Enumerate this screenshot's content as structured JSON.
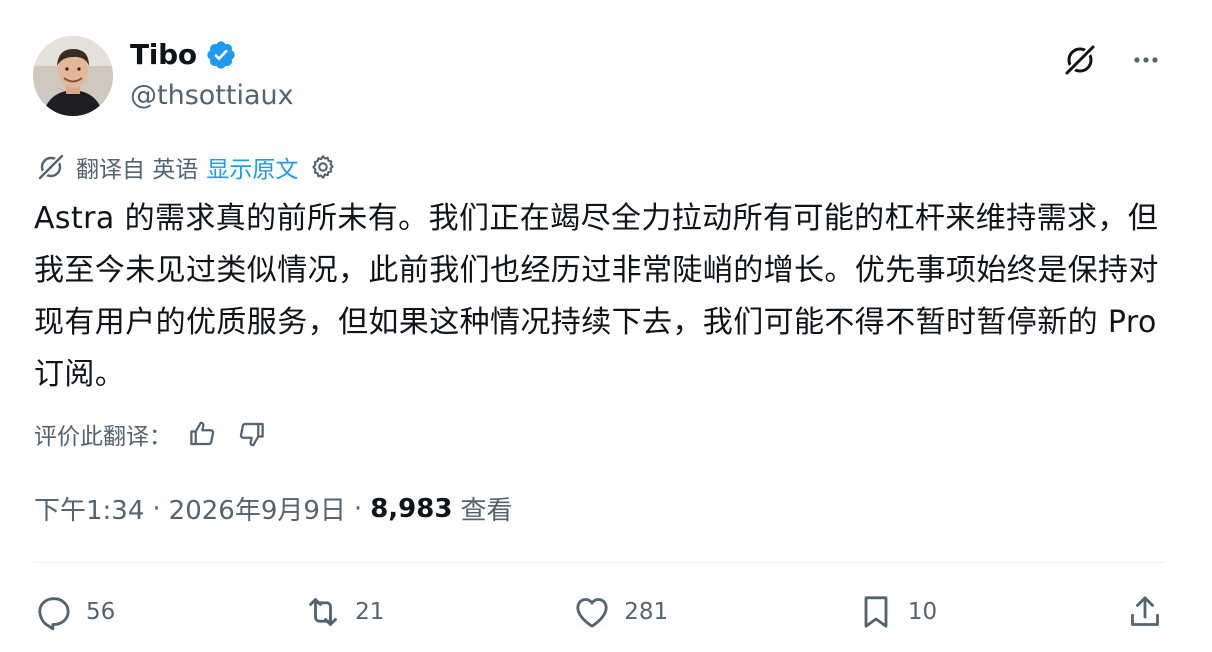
{
  "author": {
    "display_name": "Tibo",
    "handle": "@thsottiaux",
    "verified_color": "#1d9bf0"
  },
  "header_actions": {
    "grok_icon": "grok-icon",
    "more_icon": "more-icon"
  },
  "translation": {
    "translated_from": "翻译自 英语",
    "show_original": "显示原文",
    "settings_icon": "gear-icon"
  },
  "tweet": {
    "text": "Astra 的需求真的前所未有。我们正在竭尽全力拉动所有可能的杠杆来维持需求，但我至今未见过类似情况，此前我们也经历过非常陡峭的增长。优先事项始终是保持对现有用户的优质服务，但如果这种情况持续下去，我们可能不得不暂时暂停新的 Pro 订阅。"
  },
  "rate_translation": {
    "label": "评价此翻译："
  },
  "meta": {
    "time": "下午1:34",
    "date": "2026年9月9日",
    "separator": "·",
    "views_count": "8,983",
    "views_label": "查看"
  },
  "actions": {
    "replies": "56",
    "reposts": "21",
    "likes": "281",
    "bookmarks": "10"
  },
  "colors": {
    "text": "#0f1419",
    "secondary": "#536471",
    "accent": "#1d9bf0",
    "divider": "#eff3f4"
  }
}
